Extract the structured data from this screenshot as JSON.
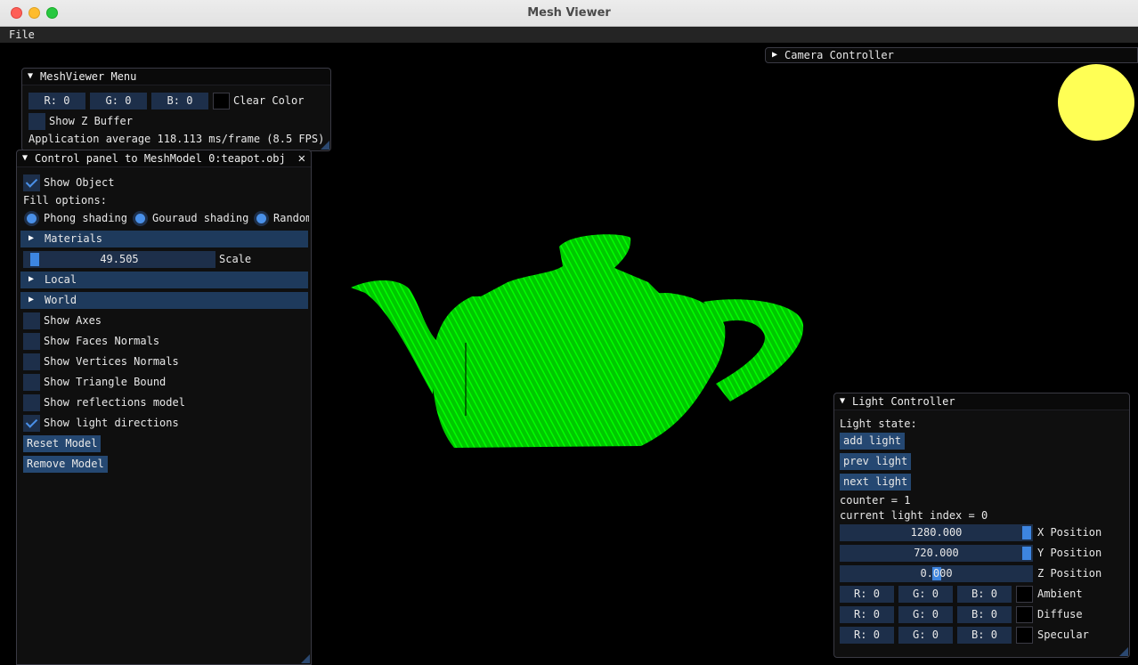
{
  "window": {
    "title": "Mesh Viewer"
  },
  "menubar": {
    "file": "File"
  },
  "mesh_menu": {
    "title": "MeshViewer Menu",
    "clear_r": "R:  0",
    "clear_g": "G:  0",
    "clear_b": "B:  0",
    "clear_color_label": "Clear Color",
    "show_z_buffer": "Show Z Buffer",
    "fps_text": "Application average 118.113 ms/frame (8.5 FPS)"
  },
  "control_panel": {
    "title": "Control panel to MeshModel 0:teapot.obj",
    "show_object": "Show Object",
    "fill_options": "Fill options:",
    "radio_phong": "Phong shading",
    "radio_gouraud": "Gouraud shading",
    "radio_random": "Random",
    "materials": "Materials",
    "scale_value": "49.505",
    "scale_label": "Scale",
    "scale_fraction": 0.03,
    "local": "Local",
    "world": "World",
    "show_axes": "Show Axes",
    "show_faces_normals": "Show Faces Normals",
    "show_vertices_normals": "Show Vertices Normals",
    "show_triangle_bound": "Show Triangle Bound",
    "show_reflections": "Show reflections model",
    "show_light_directions": "Show light directions",
    "reset_model": "Reset Model",
    "remove_model": "Remove Model"
  },
  "camera_controller": {
    "title": "Camera Controller"
  },
  "light_controller": {
    "title": "Light Controller",
    "light_state": "Light state:",
    "add_light": "add light",
    "prev_light": "prev light",
    "next_light": "next light",
    "counter": "counter = 1",
    "current_index": "current light index = 0",
    "x_value": "1280.000",
    "x_label": "X Position",
    "x_fraction": 1.0,
    "y_value": "720.000",
    "y_label": "Y Position",
    "y_fraction": 1.0,
    "z_value": "0.000",
    "z_label": "Z Position",
    "z_fraction": 0.5,
    "r": "R:  0",
    "g": "G:  0",
    "b": "B:  0",
    "ambient": "Ambient",
    "diffuse": "Diffuse",
    "specular": "Specular"
  },
  "colors": {
    "teapot": "#00ff00",
    "light": "#ffff55",
    "accent": "#4a90e8"
  }
}
